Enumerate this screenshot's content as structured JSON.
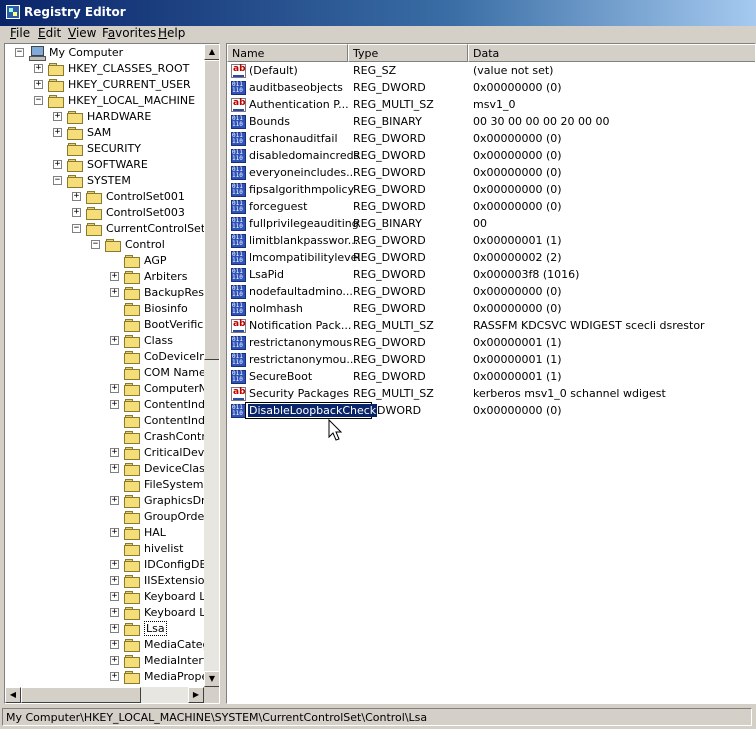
{
  "window": {
    "title": "Registry Editor",
    "icon": "registry-icon"
  },
  "menu": [
    {
      "u": "F",
      "rest": "ile"
    },
    {
      "u": "E",
      "rest": "dit"
    },
    {
      "u": "V",
      "rest": "iew"
    },
    {
      "pre": "F",
      "u": "a",
      "rest": "vorites"
    },
    {
      "u": "H",
      "rest": "elp"
    }
  ],
  "tree": [
    {
      "label": "My Computer",
      "depth": 0,
      "exp": "-",
      "icon": "computer-icon"
    },
    {
      "label": "HKEY_CLASSES_ROOT",
      "depth": 1,
      "exp": "+"
    },
    {
      "label": "HKEY_CURRENT_USER",
      "depth": 1,
      "exp": "+"
    },
    {
      "label": "HKEY_LOCAL_MACHINE",
      "depth": 1,
      "exp": "-"
    },
    {
      "label": "HARDWARE",
      "depth": 2,
      "exp": "+"
    },
    {
      "label": "SAM",
      "depth": 2,
      "exp": "+"
    },
    {
      "label": "SECURITY",
      "depth": 2,
      "exp": ""
    },
    {
      "label": "SOFTWARE",
      "depth": 2,
      "exp": "+"
    },
    {
      "label": "SYSTEM",
      "depth": 2,
      "exp": "-"
    },
    {
      "label": "ControlSet001",
      "depth": 3,
      "exp": "+"
    },
    {
      "label": "ControlSet003",
      "depth": 3,
      "exp": "+"
    },
    {
      "label": "CurrentControlSet",
      "depth": 3,
      "exp": "-"
    },
    {
      "label": "Control",
      "depth": 4,
      "exp": "-"
    },
    {
      "label": "AGP",
      "depth": 5,
      "exp": ""
    },
    {
      "label": "Arbiters",
      "depth": 5,
      "exp": "+"
    },
    {
      "label": "BackupRestore",
      "depth": 5,
      "exp": "+"
    },
    {
      "label": "Biosinfo",
      "depth": 5,
      "exp": ""
    },
    {
      "label": "BootVerificationProgram",
      "depth": 5,
      "exp": ""
    },
    {
      "label": "Class",
      "depth": 5,
      "exp": "+"
    },
    {
      "label": "CoDeviceInstallers",
      "depth": 5,
      "exp": ""
    },
    {
      "label": "COM Name Arbiter",
      "depth": 5,
      "exp": ""
    },
    {
      "label": "ComputerName",
      "depth": 5,
      "exp": "+"
    },
    {
      "label": "ContentIndex",
      "depth": 5,
      "exp": "+"
    },
    {
      "label": "ContentIndexCommon",
      "depth": 5,
      "exp": ""
    },
    {
      "label": "CrashControl",
      "depth": 5,
      "exp": ""
    },
    {
      "label": "CriticalDeviceDatabase",
      "depth": 5,
      "exp": "+"
    },
    {
      "label": "DeviceClasses",
      "depth": 5,
      "exp": "+"
    },
    {
      "label": "FileSystem",
      "depth": 5,
      "exp": ""
    },
    {
      "label": "GraphicsDrivers",
      "depth": 5,
      "exp": "+"
    },
    {
      "label": "GroupOrderList",
      "depth": 5,
      "exp": ""
    },
    {
      "label": "HAL",
      "depth": 5,
      "exp": "+"
    },
    {
      "label": "hivelist",
      "depth": 5,
      "exp": ""
    },
    {
      "label": "IDConfigDB",
      "depth": 5,
      "exp": "+"
    },
    {
      "label": "IISExtensions",
      "depth": 5,
      "exp": "+"
    },
    {
      "label": "Keyboard Layout",
      "depth": 5,
      "exp": "+"
    },
    {
      "label": "Keyboard Layouts",
      "depth": 5,
      "exp": "+"
    },
    {
      "label": "Lsa",
      "depth": 5,
      "exp": "+",
      "open": true
    },
    {
      "label": "MediaCategories",
      "depth": 5,
      "exp": "+"
    },
    {
      "label": "MediaInterfaces",
      "depth": 5,
      "exp": "+"
    },
    {
      "label": "MediaProperties",
      "depth": 5,
      "exp": "+"
    }
  ],
  "columns": [
    "Name",
    "Type",
    "Data"
  ],
  "rows": [
    {
      "icon": "str",
      "name": "(Default)",
      "type": "REG_SZ",
      "data": "(value not set)"
    },
    {
      "icon": "bin",
      "name": "auditbaseobjects",
      "type": "REG_DWORD",
      "data": "0x00000000 (0)"
    },
    {
      "icon": "str",
      "name": "Authentication P...",
      "type": "REG_MULTI_SZ",
      "data": "msv1_0"
    },
    {
      "icon": "bin",
      "name": "Bounds",
      "type": "REG_BINARY",
      "data": "00 30 00 00 00 20 00 00"
    },
    {
      "icon": "bin",
      "name": "crashonauditfail",
      "type": "REG_DWORD",
      "data": "0x00000000 (0)"
    },
    {
      "icon": "bin",
      "name": "disabledomaincreds",
      "type": "REG_DWORD",
      "data": "0x00000000 (0)"
    },
    {
      "icon": "bin",
      "name": "everyoneincludes...",
      "type": "REG_DWORD",
      "data": "0x00000000 (0)"
    },
    {
      "icon": "bin",
      "name": "fipsalgorithmpolicy",
      "type": "REG_DWORD",
      "data": "0x00000000 (0)"
    },
    {
      "icon": "bin",
      "name": "forceguest",
      "type": "REG_DWORD",
      "data": "0x00000000 (0)"
    },
    {
      "icon": "bin",
      "name": "fullprivilegeauditing",
      "type": "REG_BINARY",
      "data": "00"
    },
    {
      "icon": "bin",
      "name": "limitblankpasswor...",
      "type": "REG_DWORD",
      "data": "0x00000001 (1)"
    },
    {
      "icon": "bin",
      "name": "lmcompatibilitylevel",
      "type": "REG_DWORD",
      "data": "0x00000002 (2)"
    },
    {
      "icon": "bin",
      "name": "LsaPid",
      "type": "REG_DWORD",
      "data": "0x000003f8 (1016)"
    },
    {
      "icon": "bin",
      "name": "nodefaultadmino...",
      "type": "REG_DWORD",
      "data": "0x00000000 (0)"
    },
    {
      "icon": "bin",
      "name": "nolmhash",
      "type": "REG_DWORD",
      "data": "0x00000000 (0)"
    },
    {
      "icon": "str",
      "name": "Notification Pack...",
      "type": "REG_MULTI_SZ",
      "data": "RASSFM KDCSVC WDIGEST scecli dsrestor"
    },
    {
      "icon": "bin",
      "name": "restrictanonymous",
      "type": "REG_DWORD",
      "data": "0x00000001 (1)"
    },
    {
      "icon": "bin",
      "name": "restrictanonymou...",
      "type": "REG_DWORD",
      "data": "0x00000001 (1)"
    },
    {
      "icon": "bin",
      "name": "SecureBoot",
      "type": "REG_DWORD",
      "data": "0x00000001 (1)"
    },
    {
      "icon": "str",
      "name": "Security Packages",
      "type": "REG_MULTI_SZ",
      "data": "kerberos msv1_0 schannel wdigest"
    },
    {
      "icon": "bin",
      "name": "DisableLoopbackCheck",
      "type": "REG_DWORD",
      "data": "0x00000000 (0)",
      "editing": true
    }
  ],
  "status": "My Computer\\HKEY_LOCAL_MACHINE\\SYSTEM\\CurrentControlSet\\Control\\Lsa"
}
